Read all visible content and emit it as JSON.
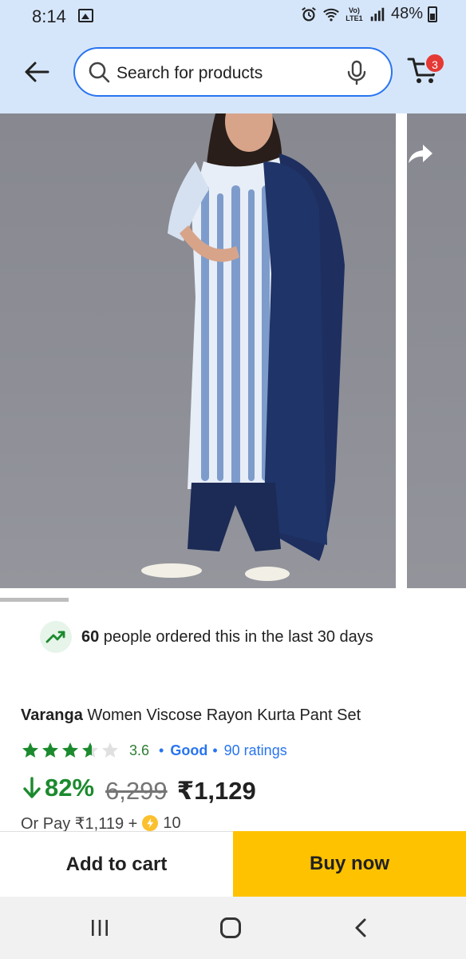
{
  "status": {
    "time": "8:14",
    "lte": "Vo) LTE1",
    "battery": "48%"
  },
  "header": {
    "search_placeholder": "Search for products",
    "cart_count": "3"
  },
  "orders": {
    "count": "60",
    "text": " people ordered this in the last 30 days"
  },
  "product": {
    "brand": "Varanga",
    "title": " Women Viscose Rayon Kurta Pant Set",
    "rating": {
      "value": "3.6",
      "stars": 3.6,
      "separator": "•",
      "label": "Good",
      "count": "90 ratings",
      "star_color": "#1b8a2e"
    },
    "discount": "82%",
    "mrp": "6,299",
    "price": "₹1,129",
    "pay_prefix": "Or Pay ₹1,119 +",
    "coins": "10"
  },
  "actions": {
    "add_to_cart": "Add to cart",
    "buy_now": "Buy now"
  },
  "colors": {
    "header_bg": "#d6e6fa",
    "accent_blue": "#2874f0",
    "buy_now": "#ffc200",
    "discount_green": "#1b8a2e"
  }
}
